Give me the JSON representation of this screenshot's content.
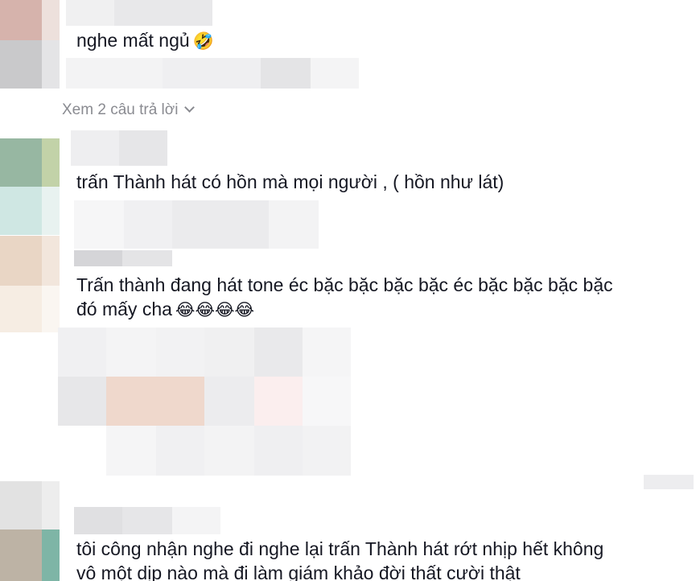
{
  "comments": [
    {
      "text": "nghe mất ngủ",
      "emoji": "🤣"
    },
    {
      "text": "trấn Thành hát có hồn mà mọi người , ( hồn như lát)"
    },
    {
      "text_line1": "Trấn thành đang hát tone éc bặc bặc bặc bặc éc bặc bặc bặc bặc",
      "text_line2": "đó mấy cha",
      "emoji": "😂😂😂😂"
    },
    {
      "text_line1": "tôi công nhận nghe đi nghe lại trấn Thành hát rớt nhịp hết không",
      "text_line2": "vô một dịp nào mà đi làm giám khảo đời thất cười thật"
    }
  ],
  "replies_link": {
    "label": "Xem 2 câu trả lời",
    "icon": "chevron-down-icon"
  },
  "colors": {
    "text": "#161823",
    "muted": "#8a8b91",
    "blur_light": "#f1f1f2",
    "blur_mid": "#e3e3e5"
  }
}
